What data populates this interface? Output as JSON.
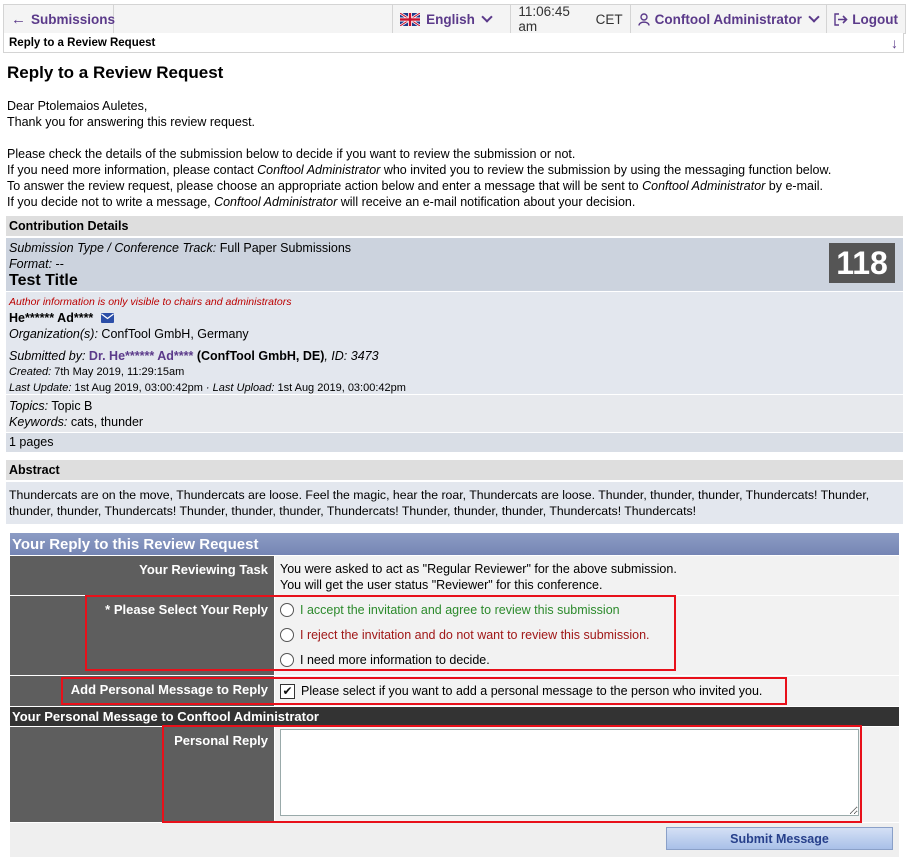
{
  "nav": {
    "back_label": "Submissions",
    "language": "English",
    "time": "11:06:45 am",
    "timezone": "CET",
    "user": "Conftool Administrator",
    "logout": "Logout"
  },
  "breadcrumb": "Reply to a Review Request",
  "title": "Reply to a Review Request",
  "intro": {
    "greeting": "Dear Ptolemaios Auletes,",
    "thanks": "Thank you for answering this review request.",
    "line1": "Please check the details of the submission below to decide if you want to review the submission or not.",
    "line2_a": "If you need more information, please contact ",
    "line2_b": "Conftool Administrator",
    "line2_c": " who invited you to review the submission by using the messaging function below.",
    "line3_a": "To answer the review request, please choose an appropriate action below and enter a message that will be sent to ",
    "line3_b": "Conftool Administrator",
    "line3_c": " by e-mail.",
    "line4_a": "If you decide not to write a message, ",
    "line4_b": "Conftool Administrator",
    "line4_c": " will receive an e-mail notification about your decision."
  },
  "contribution": {
    "header": "Contribution Details",
    "type_label": "Submission Type / Conference Track:",
    "type_value": " Full Paper Submissions",
    "format_label": "Format:",
    "format_value": " --",
    "paper_title": "Test Title",
    "paper_number": "118",
    "author_note": "Author information is only visible to chairs and administrators",
    "author_name": "He****** Ad****",
    "org_label": "Organization(s):",
    "org_value": " ConfTool GmbH, Germany",
    "submitted_label": "Submitted by:",
    "submitted_name": " Dr. He****** Ad****",
    "submitted_org": " (ConfTool GmbH, DE)",
    "submitted_id": ", ID: 3473",
    "created_label": "Created:",
    "created_value": " 7th May 2019, 11:29:15am",
    "update_label": "Last Update:",
    "update_value": " 1st Aug 2019, 03:00:42pm",
    "upload_label": " · Last Upload:",
    "upload_value": " 1st Aug 2019, 03:00:42pm",
    "topics_label": "Topics:",
    "topics_value": " Topic B",
    "keywords_label": "Keywords:",
    "keywords_value": " cats, thunder",
    "pages": "1 pages"
  },
  "abstract": {
    "header": "Abstract",
    "text": "Thundercats are on the move, Thundercats are loose. Feel the magic, hear the roar, Thundercats are loose. Thunder, thunder, thunder, Thundercats! Thunder, thunder, thunder, Thundercats! Thunder, thunder, thunder, Thundercats! Thunder, thunder, thunder, Thundercats! Thundercats!"
  },
  "reply": {
    "header": "Your Reply to this Review Request",
    "task_label": "Your Reviewing Task",
    "task_line1": "You were asked to act as \"Regular Reviewer\" for the above submission.",
    "task_line2": "You will get the user status \"Reviewer\" for this conference.",
    "select_label": "* Please Select Your Reply",
    "opt_accept": "I accept the invitation and agree to review this submission",
    "opt_reject": "I reject the invitation and do not want to review this submission.",
    "opt_info": "I need more information to decide.",
    "personal_label": "Add Personal Message to Reply",
    "personal_check": "Please select if you want to add a personal message to the person who invited you.",
    "msg_header": "Your Personal Message to Conftool Administrator",
    "personal_reply_label": "Personal Reply",
    "submit": "Submit Message"
  }
}
